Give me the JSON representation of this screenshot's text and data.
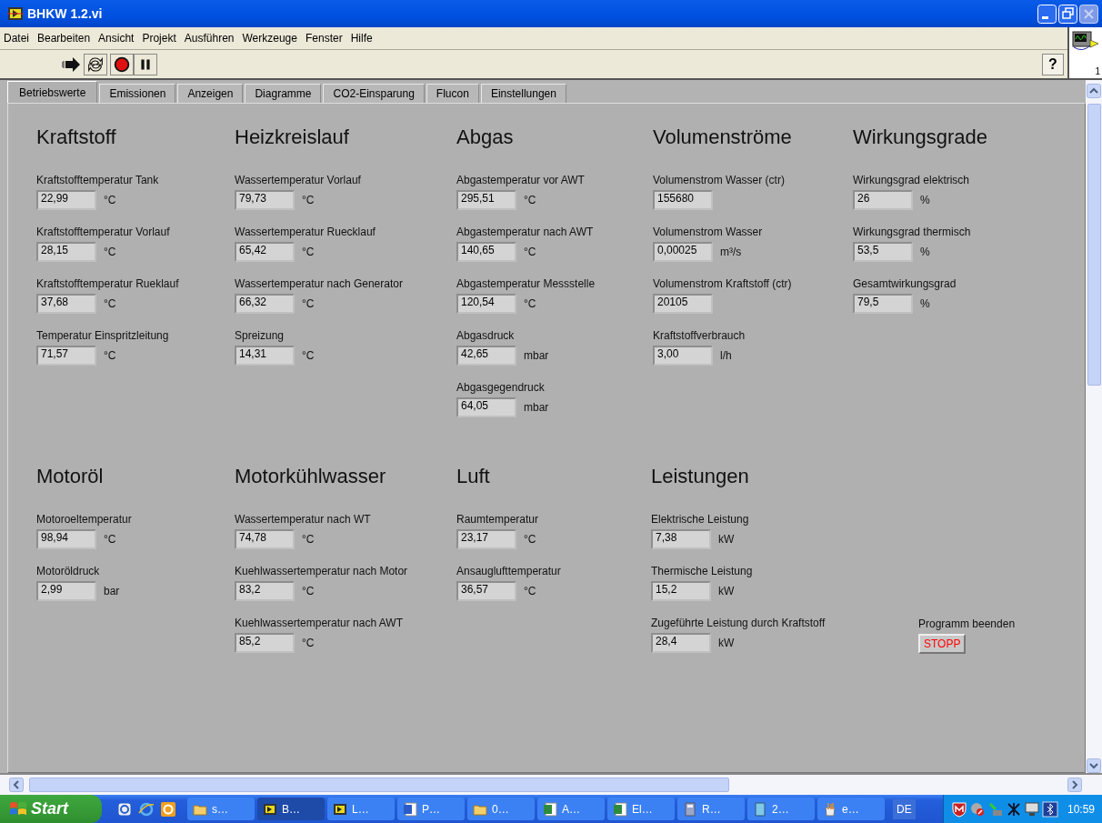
{
  "window": {
    "title": "BHKW 1.2.vi"
  },
  "menu": [
    "Datei",
    "Bearbeiten",
    "Ansicht",
    "Projekt",
    "Ausführen",
    "Werkzeuge",
    "Fenster",
    "Hilfe"
  ],
  "help_button": {
    "label": "?"
  },
  "connector": {
    "label": "1"
  },
  "tabs": [
    {
      "label": "Betriebswerte",
      "selected": true
    },
    {
      "label": "Emissionen",
      "selected": false
    },
    {
      "label": "Anzeigen",
      "selected": false
    },
    {
      "label": "Diagramme",
      "selected": false
    },
    {
      "label": "CO2-Einsparung",
      "selected": false
    },
    {
      "label": "Flucon",
      "selected": false
    },
    {
      "label": "Einstellungen",
      "selected": false
    }
  ],
  "sections_top": [
    {
      "title": "Kraftstoff",
      "fields": [
        {
          "label": "Kraftstofftemperatur Tank",
          "value": "22,99",
          "unit": "°C"
        },
        {
          "label": "Kraftstofftemperatur Vorlauf",
          "value": "28,15",
          "unit": "°C"
        },
        {
          "label": "Kraftstofftemperatur Rueklauf",
          "value": "37,68",
          "unit": "°C"
        },
        {
          "label": "Temperatur Einspritzleitung",
          "value": "71,57",
          "unit": "°C"
        }
      ]
    },
    {
      "title": "Heizkreislauf",
      "fields": [
        {
          "label": "Wassertemperatur Vorlauf",
          "value": "79,73",
          "unit": "°C"
        },
        {
          "label": "Wassertemperatur Ruecklauf",
          "value": "65,42",
          "unit": "°C"
        },
        {
          "label": "Wassertemperatur nach Generator",
          "value": "66,32",
          "unit": "°C"
        },
        {
          "label": "Spreizung",
          "value": "14,31",
          "unit": "°C"
        }
      ]
    },
    {
      "title": "Abgas",
      "fields": [
        {
          "label": "Abgastemperatur vor AWT",
          "value": "295,51",
          "unit": "°C"
        },
        {
          "label": "Abgastemperatur nach AWT",
          "value": "140,65",
          "unit": "°C"
        },
        {
          "label": "Abgastemperatur Messstelle",
          "value": "120,54",
          "unit": "°C"
        },
        {
          "label": "Abgasdruck",
          "value": "42,65",
          "unit": "mbar"
        },
        {
          "label": "Abgasgegendruck",
          "value": "64,05",
          "unit": "mbar"
        }
      ]
    },
    {
      "title": "Volumenströme",
      "fields": [
        {
          "label": "Volumenstrom Wasser (ctr)",
          "value": "155680"
        },
        {
          "label": "Volumenstrom Wasser",
          "value": "0,00025",
          "unit": "m³/s"
        },
        {
          "label": "Volumenstrom Kraftstoff (ctr)",
          "value": "20105"
        },
        {
          "label": "Kraftstoffverbrauch",
          "value": "3,00",
          "unit": "l/h"
        }
      ]
    },
    {
      "title": "Wirkungsgrade",
      "fields": [
        {
          "label": "Wirkungsgrad elektrisch",
          "value": "26",
          "unit": "%"
        },
        {
          "label": "Wirkungsgrad thermisch",
          "value": "53,5",
          "unit": "%"
        },
        {
          "label": "Gesamtwirkungsgrad",
          "value": "79,5",
          "unit": "%"
        }
      ]
    }
  ],
  "sections_bottom": [
    {
      "title": "Motoröl",
      "fields": [
        {
          "label": "Motoroeltemperatur",
          "value": "98,94",
          "unit": "°C"
        },
        {
          "label": "Motoröldruck",
          "value": "2,99",
          "unit": "bar"
        }
      ]
    },
    {
      "title": "Motorkühlwasser",
      "fields": [
        {
          "label": "Wassertemperatur nach WT",
          "value": "74,78",
          "unit": "°C"
        },
        {
          "label": "Kuehlwassertemperatur nach Motor",
          "value": "83,2",
          "unit": "°C"
        },
        {
          "label": "Kuehlwassertemperatur nach AWT",
          "value": "85,2",
          "unit": "°C"
        }
      ]
    },
    {
      "title": "Luft",
      "fields": [
        {
          "label": "Raumtemperatur",
          "value": "23,17",
          "unit": "°C"
        },
        {
          "label": "Ansauglufttemperatur",
          "value": "36,57",
          "unit": "°C"
        }
      ]
    },
    {
      "title": "Leistungen",
      "fields": [
        {
          "label": "Elektrische Leistung",
          "value": "7,38",
          "unit": "kW"
        },
        {
          "label": "Thermische Leistung",
          "value": "15,2",
          "unit": "kW"
        },
        {
          "label": "Zugeführte Leistung durch Kraftstoff",
          "value": "28,4",
          "unit": "kW"
        }
      ]
    }
  ],
  "stop": {
    "label": "Programm beenden",
    "button": "STOPP"
  },
  "taskbar": {
    "start": "Start",
    "tasks": [
      {
        "label": "s…",
        "kind": "folder",
        "selected": false
      },
      {
        "label": "B…",
        "kind": "labview",
        "selected": true
      },
      {
        "label": "L…",
        "kind": "labview",
        "selected": false
      },
      {
        "label": "P…",
        "kind": "word",
        "selected": false
      },
      {
        "label": "0…",
        "kind": "folder",
        "selected": false
      },
      {
        "label": "A…",
        "kind": "excel",
        "selected": false
      },
      {
        "label": "El…",
        "kind": "excel",
        "selected": false
      },
      {
        "label": "R…",
        "kind": "calc",
        "selected": false
      },
      {
        "label": "2…",
        "kind": "notepad",
        "selected": false
      },
      {
        "label": "e…",
        "kind": "paint",
        "selected": false
      }
    ],
    "language": "DE",
    "clock": "10:59"
  }
}
